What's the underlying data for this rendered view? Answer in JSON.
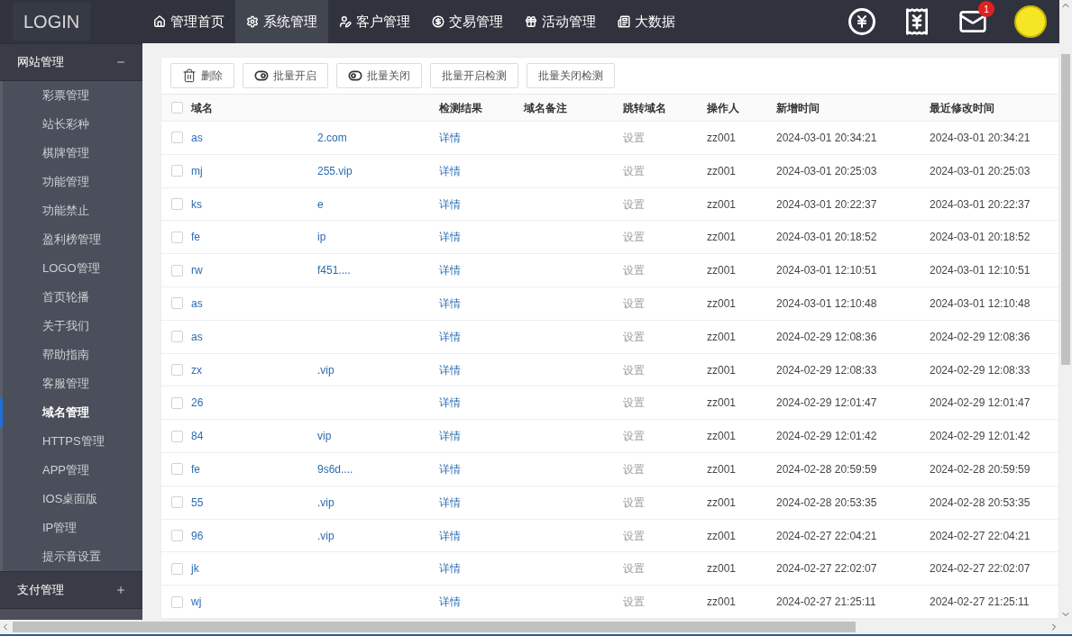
{
  "logo": "LOGIN",
  "nav": [
    {
      "label": "管理首页",
      "kind": "home",
      "selected": false
    },
    {
      "label": "系统管理",
      "kind": "gear",
      "selected": true
    },
    {
      "label": "客户管理",
      "kind": "user",
      "selected": false
    },
    {
      "label": "交易管理",
      "kind": "yen",
      "selected": false
    },
    {
      "label": "活动管理",
      "kind": "gift",
      "selected": false
    },
    {
      "label": "大数据",
      "kind": "list",
      "selected": false
    }
  ],
  "header_icons": [
    {
      "kind": "yen-refresh"
    },
    {
      "kind": "receipt"
    },
    {
      "kind": "mail",
      "badge": "1"
    }
  ],
  "sidebar": [
    {
      "label": "网站管理",
      "expanded": true,
      "children": [
        {
          "label": "彩票管理",
          "selected": false
        },
        {
          "label": "站长彩种",
          "selected": false
        },
        {
          "label": "棋牌管理",
          "selected": false
        },
        {
          "label": "功能管理",
          "selected": false
        },
        {
          "label": "功能禁止",
          "selected": false
        },
        {
          "label": "盈利榜管理",
          "selected": false
        },
        {
          "label": "LOGO管理",
          "selected": false
        },
        {
          "label": "首页轮播",
          "selected": false
        },
        {
          "label": "关于我们",
          "selected": false
        },
        {
          "label": "帮助指南",
          "selected": false
        },
        {
          "label": "客服管理",
          "selected": false
        },
        {
          "label": "域名管理",
          "selected": true
        },
        {
          "label": "HTTPS管理",
          "selected": false
        },
        {
          "label": "APP管理",
          "selected": false
        },
        {
          "label": "IOS桌面版",
          "selected": false
        },
        {
          "label": "IP管理",
          "selected": false
        },
        {
          "label": "提示音设置",
          "selected": false
        }
      ]
    },
    {
      "label": "支付管理",
      "expanded": false
    }
  ],
  "toolbar": [
    {
      "label": "删除",
      "kind": "trash"
    },
    {
      "label": "批量开启",
      "kind": "toggle-on"
    },
    {
      "label": "批量关闭",
      "kind": "toggle-off"
    },
    {
      "label": "批量开启检测",
      "kind": "plain"
    },
    {
      "label": "批量关闭检测",
      "kind": "plain"
    }
  ],
  "table": {
    "select_all": {
      "checked": false
    },
    "columns": [
      "域名",
      "检测结果",
      "域名备注",
      "跳转域名",
      "操作人",
      "新增时间",
      "最近修改时间"
    ],
    "rows": [
      {
        "checked": false,
        "domain_start": "as",
        "domain_end": "2.com",
        "result": "详情",
        "redirect": "设置",
        "operator": "zz001",
        "created": "2024-03-01 20:34:21",
        "modified": "2024-03-01 20:34:21"
      },
      {
        "checked": false,
        "domain_start": "mj",
        "domain_end": "255.vip",
        "result": "详情",
        "redirect": "设置",
        "operator": "zz001",
        "created": "2024-03-01 20:25:03",
        "modified": "2024-03-01 20:25:03"
      },
      {
        "checked": false,
        "domain_start": "ks",
        "domain_end": "e",
        "result": "详情",
        "redirect": "设置",
        "operator": "zz001",
        "created": "2024-03-01 20:22:37",
        "modified": "2024-03-01 20:22:37"
      },
      {
        "checked": false,
        "domain_start": "fe",
        "domain_end": "ip",
        "result": "详情",
        "redirect": "设置",
        "operator": "zz001",
        "created": "2024-03-01 20:18:52",
        "modified": "2024-03-01 20:18:52"
      },
      {
        "checked": false,
        "domain_start": "rw",
        "domain_end": "f451....",
        "result": "详情",
        "redirect": "设置",
        "operator": "zz001",
        "created": "2024-03-01 12:10:51",
        "modified": "2024-03-01 12:10:51"
      },
      {
        "checked": false,
        "domain_start": "as",
        "result": "详情",
        "redirect": "设置",
        "operator": "zz001",
        "created": "2024-03-01 12:10:48",
        "modified": "2024-03-01 12:10:48"
      },
      {
        "checked": false,
        "domain_start": "as",
        "result": "详情",
        "redirect": "设置",
        "operator": "zz001",
        "created": "2024-02-29 12:08:36",
        "modified": "2024-02-29 12:08:36"
      },
      {
        "checked": false,
        "domain_start": "zx",
        "domain_end": ".vip",
        "result": "详情",
        "redirect": "设置",
        "operator": "zz001",
        "created": "2024-02-29 12:08:33",
        "modified": "2024-02-29 12:08:33"
      },
      {
        "checked": false,
        "domain_start": "26",
        "result": "详情",
        "redirect": "设置",
        "operator": "zz001",
        "created": "2024-02-29 12:01:47",
        "modified": "2024-02-29 12:01:47"
      },
      {
        "checked": false,
        "domain_start": "84",
        "domain_end": "vip",
        "result": "详情",
        "redirect": "设置",
        "operator": "zz001",
        "created": "2024-02-29 12:01:42",
        "modified": "2024-02-29 12:01:42"
      },
      {
        "checked": false,
        "domain_start": "fe",
        "domain_end": "9s6d....",
        "result": "详情",
        "redirect": "设置",
        "operator": "zz001",
        "created": "2024-02-28 20:59:59",
        "modified": "2024-02-28 20:59:59"
      },
      {
        "checked": false,
        "domain_start": "55",
        "domain_end": ".vip",
        "result": "详情",
        "redirect": "设置",
        "operator": "zz001",
        "created": "2024-02-28 20:53:35",
        "modified": "2024-02-28 20:53:35"
      },
      {
        "checked": false,
        "domain_start": "96",
        "domain_end": ".vip",
        "result": "详情",
        "redirect": "设置",
        "operator": "zz001",
        "created": "2024-02-27 22:04:21",
        "modified": "2024-02-27 22:04:21"
      },
      {
        "checked": false,
        "domain_start": "jk",
        "result": "详情",
        "redirect": "设置",
        "operator": "zz001",
        "created": "2024-02-27 22:02:07",
        "modified": "2024-02-27 22:02:07"
      },
      {
        "checked": false,
        "domain_start": "wj",
        "result": "详情",
        "redirect": "设置",
        "operator": "zz001",
        "created": "2024-02-27 21:25:11",
        "modified": "2024-02-27 21:25:11"
      }
    ]
  }
}
